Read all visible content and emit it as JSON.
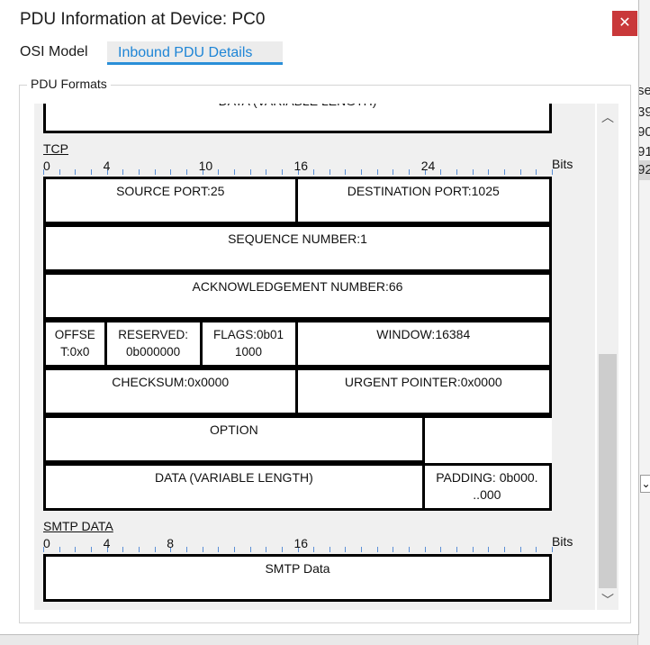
{
  "dialog": {
    "title": "PDU Information at Device: PC0",
    "close_glyph": "✕",
    "tabs": [
      {
        "label": "OSI Model",
        "active": false
      },
      {
        "label": "Inbound PDU Details",
        "active": true
      }
    ],
    "group_label": "PDU Formats"
  },
  "background_fragments": [
    "se",
    "39",
    "90",
    "91",
    "92"
  ],
  "scrollbar": {
    "up_icon": "chevron-up-icon",
    "down_icon": "chevron-down-icon",
    "up_glyph": "︿",
    "down_glyph": "﹀"
  },
  "diagram": {
    "top_partial": {
      "label": "DATA (VARIABLE LENGTH)"
    },
    "tcp": {
      "title": "TCP",
      "ruler_labels": [
        "0",
        "4",
        "10",
        "16",
        "24"
      ],
      "bits": "Bits",
      "rows": [
        [
          "SOURCE PORT:25",
          "DESTINATION PORT:1025"
        ],
        [
          "SEQUENCE NUMBER:1"
        ],
        [
          "ACKNOWLEDGEMENT NUMBER:66"
        ],
        [
          "OFFSE T:0x0",
          "RESERVED: 0b000000",
          "FLAGS:0b01 1000",
          "WINDOW:16384"
        ],
        [
          "CHECKSUM:0x0000",
          "URGENT POINTER:0x0000"
        ],
        [
          "OPTION",
          ""
        ],
        [
          "DATA (VARIABLE LENGTH)",
          "PADDING: 0b000. ..000"
        ]
      ]
    },
    "smtp": {
      "title": "SMTP DATA",
      "ruler_labels": [
        "0",
        "4",
        "8",
        "16"
      ],
      "bits": "Bits",
      "cell": "SMTP Data"
    }
  },
  "colors": {
    "accent": "#1e85d6",
    "close": "#c9383a",
    "tick": "#5b8fd6"
  }
}
